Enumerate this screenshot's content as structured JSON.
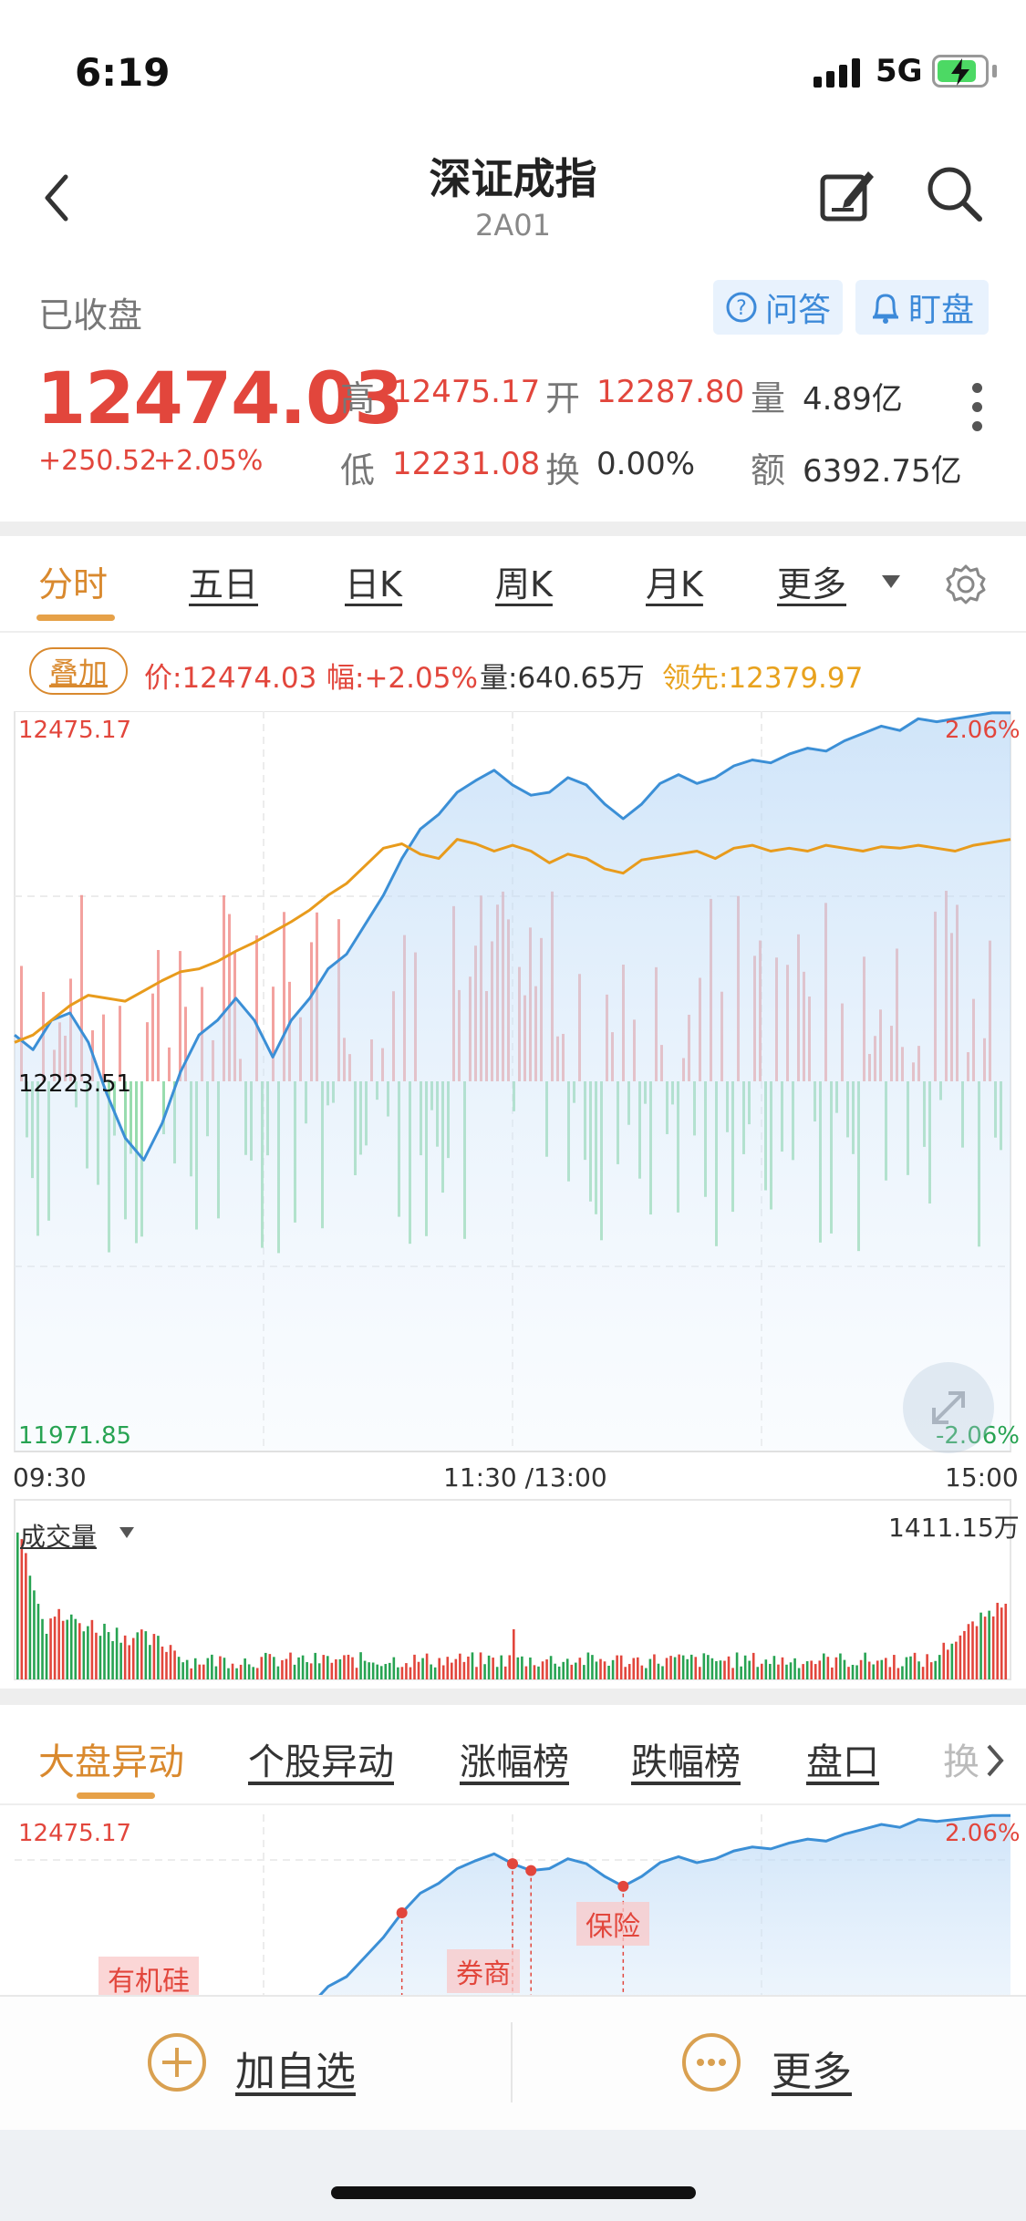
{
  "status_bar": {
    "time": "6:19",
    "network": "5G"
  },
  "header": {
    "title": "深证成指",
    "code": "2A01"
  },
  "market": {
    "status": "已收盘",
    "price": "12474.03",
    "change": "+250.52",
    "change_pct": "+2.05%",
    "actions": {
      "qa": "问答",
      "watch": "盯盘"
    },
    "stats": {
      "high_label": "高",
      "high": "12475.17",
      "open_label": "开",
      "open": "12287.80",
      "vol_label": "量",
      "vol": "4.89亿",
      "low_label": "低",
      "low": "12231.08",
      "turn_label": "换",
      "turn": "0.00%",
      "amt_label": "额",
      "amt": "6392.75亿"
    }
  },
  "chart_tabs": [
    "分时",
    "五日",
    "日K",
    "周K",
    "月K",
    "更多"
  ],
  "info_bar": {
    "overlay": "叠加",
    "price": "价:12474.03",
    "amp": "幅:+2.05%",
    "volume": "量:640.65万",
    "lead": "领先:12379.97"
  },
  "chart_data": {
    "type": "line",
    "title": "",
    "x_axis_labels": [
      "09:30",
      "11:30 /13:00",
      "15:00"
    ],
    "y_top_label": "12475.17",
    "y_mid_label": "12223.51",
    "y_bottom_label": "11971.85",
    "pct_top_label": "2.06%",
    "pct_bottom_label": "-2.06%",
    "ylim": [
      11971.85,
      12475.17
    ],
    "prev_close": 12223.51,
    "series": [
      {
        "color": "#3b8fd6",
        "values": [
          12255,
          12245,
          12265,
          12270,
          12250,
          12215,
          12185,
          12170,
          12195,
          12230,
          12255,
          12265,
          12280,
          12265,
          12240,
          12265,
          12280,
          12300,
          12310,
          12330,
          12350,
          12375,
          12395,
          12405,
          12420,
          12428,
          12435,
          12425,
          12418,
          12420,
          12430,
          12425,
          12412,
          12402,
          12412,
          12426,
          12432,
          12426,
          12430,
          12438,
          12442,
          12440,
          12446,
          12450,
          12448,
          12455,
          12460,
          12465,
          12462,
          12470,
          12468,
          12470,
          12472,
          12474,
          12474
        ]
      },
      {
        "color": "#e89b1c",
        "values": [
          12250,
          12255,
          12265,
          12275,
          12282,
          12280,
          12278,
          12285,
          12292,
          12298,
          12300,
          12305,
          12312,
          12318,
          12325,
          12332,
          12340,
          12350,
          12358,
          12370,
          12382,
          12385,
          12378,
          12375,
          12388,
          12385,
          12380,
          12384,
          12380,
          12372,
          12378,
          12375,
          12368,
          12365,
          12374,
          12376,
          12378,
          12380,
          12375,
          12382,
          12384,
          12380,
          12382,
          12380,
          12384,
          12382,
          12380,
          12383,
          12382,
          12384,
          12382,
          12380,
          12384,
          12386,
          12388
        ]
      }
    ],
    "histogram_note": "red/green bars around baseline",
    "volume_panel": {
      "label": "成交量",
      "max_label": "1411.15万"
    }
  },
  "bottom_tabs": [
    "大盘异动",
    "个股异动",
    "涨幅榜",
    "跌幅榜",
    "盘口",
    "换"
  ],
  "mini_chart": {
    "top_label": "12475.17",
    "pct_label": "2.06%",
    "tags": [
      "有机硅",
      "券商",
      "保险"
    ]
  },
  "bottom_bar": {
    "add": "加自选",
    "more": "更多"
  },
  "colors": {
    "up": "#e2463c",
    "down": "#27a352",
    "accent": "#d9892e",
    "line": "#3b8fd6",
    "avg": "#e89b1c"
  }
}
